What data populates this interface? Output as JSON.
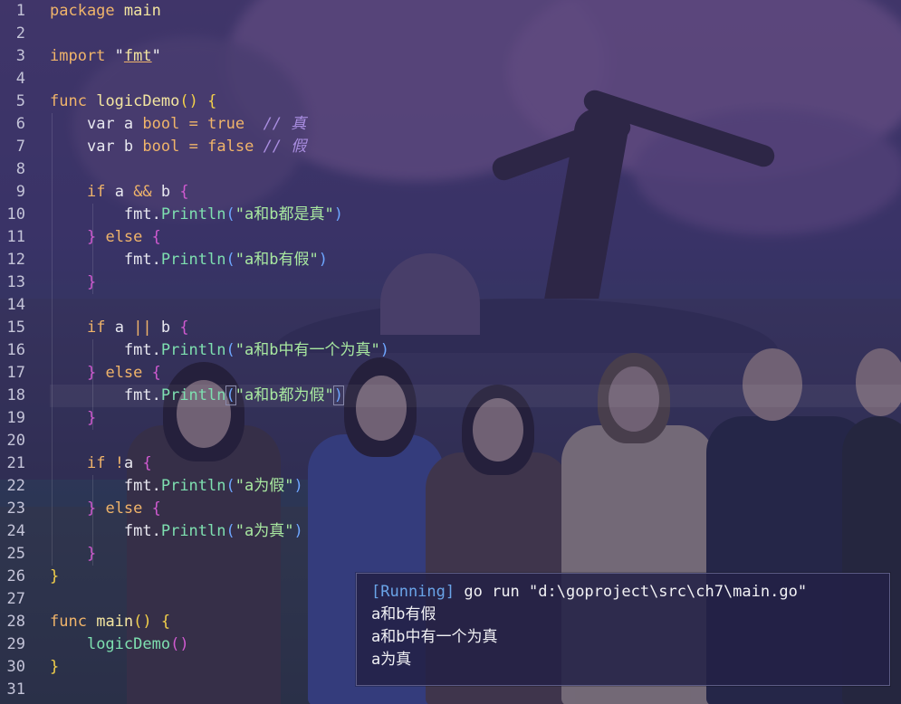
{
  "editor": {
    "line_numbers": [
      "1",
      "2",
      "3",
      "4",
      "5",
      "6",
      "7",
      "8",
      "9",
      "10",
      "11",
      "12",
      "13",
      "14",
      "15",
      "16",
      "17",
      "18",
      "19",
      "20",
      "21",
      "22",
      "23",
      "24",
      "25",
      "26",
      "27",
      "28",
      "29",
      "30",
      "31"
    ],
    "code": {
      "l1_kw": "package",
      "l1_name": "main",
      "l3_kw": "import",
      "l3_q1": "\"",
      "l3_pkg": "fmt",
      "l3_q2": "\"",
      "l5_kw": "func",
      "l5_name": "logicDemo",
      "l5_parens": "()",
      "l5_brace": "{",
      "l6_var": "var",
      "l6_ident": "a",
      "l6_type": "bool",
      "l6_eq": "=",
      "l6_val": "true",
      "l6_comment": "// 真",
      "l7_var": "var",
      "l7_ident": "b",
      "l7_type": "bool",
      "l7_eq": "=",
      "l7_val": "false",
      "l7_comment": "// 假",
      "l9_if": "if",
      "l9_cond_a": "a",
      "l9_op": "&&",
      "l9_cond_b": "b",
      "l9_brace": "{",
      "l10_pkg": "fmt.",
      "l10_call": "Println",
      "l10_str": "\"a和b都是真\"",
      "l11_close": "}",
      "l11_else": "else",
      "l11_brace": "{",
      "l12_pkg": "fmt.",
      "l12_call": "Println",
      "l12_str": "\"a和b有假\"",
      "l13_close": "}",
      "l15_if": "if",
      "l15_cond_a": "a",
      "l15_op": "||",
      "l15_cond_b": "b",
      "l15_brace": "{",
      "l16_pkg": "fmt.",
      "l16_call": "Println",
      "l16_str": "\"a和b中有一个为真\"",
      "l17_close": "}",
      "l17_else": "else",
      "l17_brace": "{",
      "l18_pkg": "fmt.",
      "l18_call": "Println",
      "l18_str": "\"a和b都为假\"",
      "l19_close": "}",
      "l21_if": "if",
      "l21_op": "!",
      "l21_cond": "a",
      "l21_brace": "{",
      "l22_pkg": "fmt.",
      "l22_call": "Println",
      "l22_str": "\"a为假\"",
      "l23_close": "}",
      "l23_else": "else",
      "l23_brace": "{",
      "l24_pkg": "fmt.",
      "l24_call": "Println",
      "l24_str": "\"a为真\"",
      "l25_close": "}",
      "l26_close": "}",
      "l28_kw": "func",
      "l28_name": "main",
      "l28_parens": "()",
      "l28_brace": "{",
      "l29_call": "logicDemo",
      "l29_parens": "()",
      "l30_close": "}",
      "paren_open": "(",
      "paren_close": ")"
    }
  },
  "output": {
    "running_tag": "[Running]",
    "command": "go run \"d:\\goproject\\src\\ch7\\main.go\"",
    "lines": [
      "a和b有假",
      "a和b中有一个为真",
      "a为真"
    ]
  },
  "colors": {
    "keyword": "#f0b46a",
    "function": "#f3e5a0",
    "call": "#7ee0b0",
    "string": "#a8e8a0",
    "comment": "#a98de0",
    "running": "#6aa4e8"
  }
}
